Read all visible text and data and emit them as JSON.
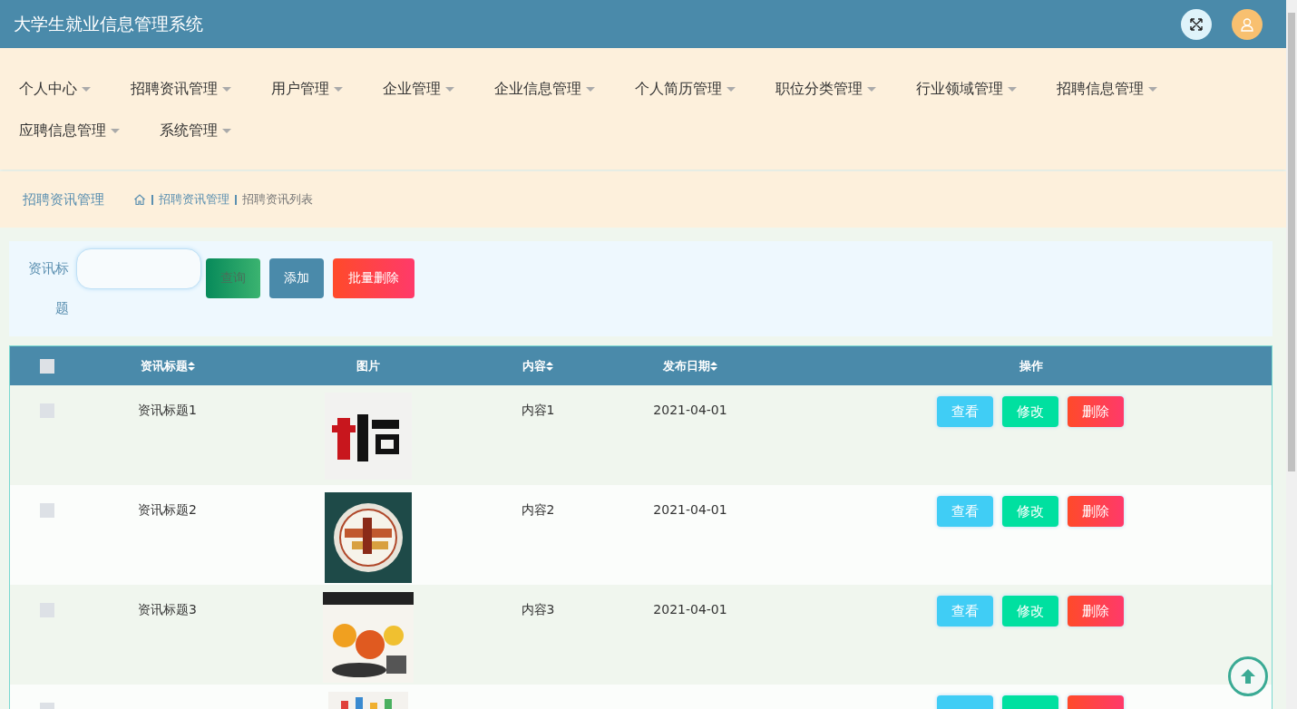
{
  "window": {
    "title": "大学生就业信息管理系统"
  },
  "nav": [
    {
      "label": "个人中心"
    },
    {
      "label": "招聘资讯管理"
    },
    {
      "label": "用户管理"
    },
    {
      "label": "企业管理"
    },
    {
      "label": "企业信息管理"
    },
    {
      "label": "个人简历管理"
    },
    {
      "label": "职位分类管理"
    },
    {
      "label": "行业领域管理"
    },
    {
      "label": "招聘信息管理"
    },
    {
      "label": "应聘信息管理"
    },
    {
      "label": "系统管理"
    }
  ],
  "breadcrumb": {
    "title": "招聘资讯管理",
    "path": [
      "招聘资讯管理",
      "招聘资讯列表"
    ]
  },
  "search": {
    "label": "资讯标题",
    "buttons": [
      {
        "label": "查询",
        "kind": "search"
      },
      {
        "label": "添加",
        "kind": "add"
      },
      {
        "label": "批量删除",
        "kind": "danger"
      }
    ]
  },
  "table": {
    "select_all": {
      "checked": false
    },
    "columns": [
      {
        "label": "资讯标题",
        "sortable": true
      },
      {
        "label": "图片",
        "sortable": false
      },
      {
        "label": "内容",
        "sortable": true
      },
      {
        "label": "发布日期",
        "sortable": true
      },
      {
        "label": "操作",
        "sortable": false
      }
    ],
    "rows": [
      {
        "checked": false,
        "title": "资讯标题1",
        "image": {
          "kind": "picture"
        },
        "content": "内容1",
        "date": "2021-04-01",
        "actions": [
          {
            "label": "查看",
            "kind": "view"
          },
          {
            "label": "修改",
            "kind": "edit"
          },
          {
            "label": "删除",
            "kind": "delete"
          }
        ]
      },
      {
        "checked": false,
        "title": "资讯标题2",
        "image": {
          "kind": "picture"
        },
        "content": "内容2",
        "date": "2021-04-01",
        "actions": [
          {
            "label": "查看",
            "kind": "view"
          },
          {
            "label": "修改",
            "kind": "edit"
          },
          {
            "label": "删除",
            "kind": "delete"
          }
        ]
      },
      {
        "checked": false,
        "title": "资讯标题3",
        "image": {
          "kind": "picture"
        },
        "content": "内容3",
        "date": "2021-04-01",
        "actions": [
          {
            "label": "查看",
            "kind": "view"
          },
          {
            "label": "修改",
            "kind": "edit"
          },
          {
            "label": "删除",
            "kind": "delete"
          }
        ]
      },
      {
        "checked": false,
        "image": {
          "kind": "picture"
        },
        "actions": [
          {
            "kind": "view"
          },
          {
            "kind": "edit"
          },
          {
            "kind": "delete"
          }
        ]
      }
    ]
  }
}
